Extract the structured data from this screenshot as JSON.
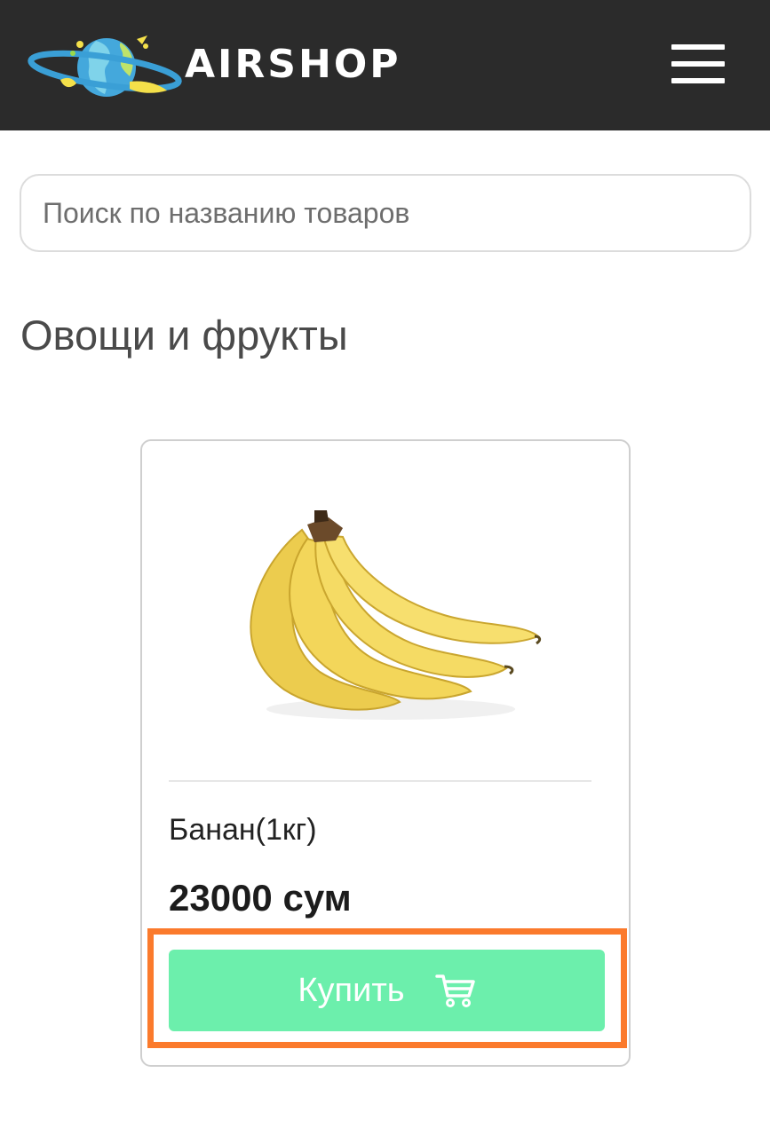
{
  "header": {
    "brand": "AIRSHOP",
    "logo_icon": "planet-logo-icon",
    "menu_icon": "hamburger-menu-icon",
    "background_color": "#2b2b2b"
  },
  "search": {
    "placeholder": "Поиск по названию товаров",
    "value": ""
  },
  "category": {
    "title": "Овощи и фрукты"
  },
  "product": {
    "image_icon": "banana-image",
    "name": "Банан(1кг)",
    "price": "23000 сум",
    "buy_label": "Купить",
    "cart_icon": "cart-icon",
    "button_color": "#6cefac",
    "highlight_color": "#fb7a2c"
  }
}
